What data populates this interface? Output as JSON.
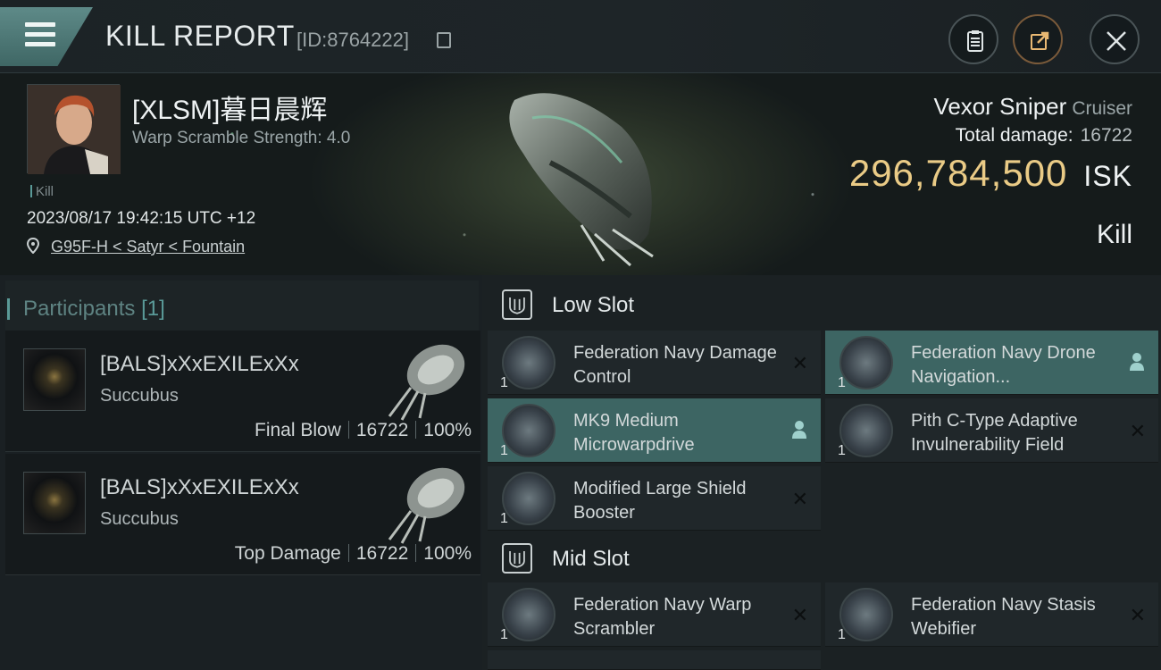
{
  "header": {
    "title": "KILL REPORT",
    "report_id": "[ID:8764222]"
  },
  "victim": {
    "pilot_name": "[XLSM]暮日晨辉",
    "warp_scramble": "Warp Scramble Strength: 4.0",
    "kill_tag": "Kill",
    "timestamp": "2023/08/17 19:42:15 UTC +12",
    "location": "G95F-H < Satyr < Fountain",
    "ship_name": "Vexor Sniper",
    "ship_class": "Cruiser",
    "total_damage_label": "Total damage:",
    "total_damage": "16722",
    "isk_value": "296,784,500",
    "isk_unit": "ISK",
    "kill_label": "Kill"
  },
  "participants": {
    "title": "Participants",
    "count": "[1]",
    "cards": [
      {
        "name": "[BALS]xXxEXILExXx",
        "ship": "Succubus",
        "role": "Final Blow",
        "damage": "16722",
        "percent": "100%"
      },
      {
        "name": "[BALS]xXxEXILExXx",
        "ship": "Succubus",
        "role": "Top Damage",
        "damage": "16722",
        "percent": "100%"
      }
    ]
  },
  "slots": {
    "low_title": "Low Slot",
    "mid_title": "Mid Slot",
    "low": [
      {
        "qty": "1",
        "name": "Federation Navy Damage Control",
        "state": "destroyed"
      },
      {
        "qty": "1",
        "name": "Federation Navy Drone Navigation...",
        "state": "dropped"
      },
      {
        "qty": "1",
        "name": "MK9 Medium Microwarpdrive",
        "state": "dropped"
      },
      {
        "qty": "1",
        "name": "Pith C-Type Adaptive Invulnerability Field",
        "state": "destroyed"
      },
      {
        "qty": "1",
        "name": "Modified Large Shield Booster",
        "state": "destroyed"
      }
    ],
    "mid": [
      {
        "qty": "1",
        "name": "Federation Navy Warp Scrambler",
        "state": "destroyed"
      },
      {
        "qty": "1",
        "name": "Federation Navy Stasis Webifier",
        "state": "destroyed"
      }
    ]
  },
  "colors": {
    "accent": "#5a9a98",
    "isk_gold": "#eacb86",
    "active_row": "#3d6563"
  }
}
